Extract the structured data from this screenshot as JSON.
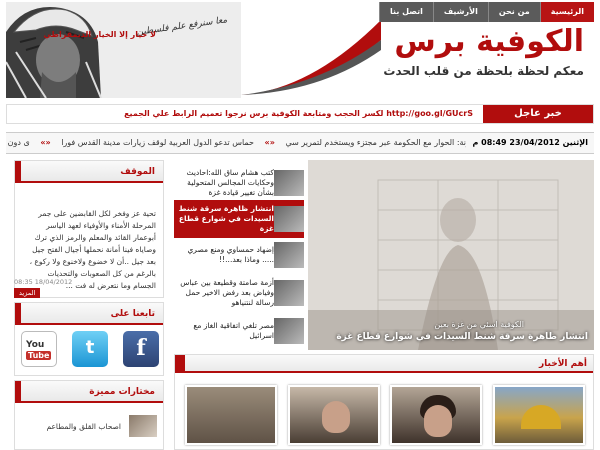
{
  "nav": {
    "items": [
      "الرئيسية",
      "من نحن",
      "الأرشيف",
      "اتصل بنا"
    ],
    "active_index": 0
  },
  "logo": {
    "title": "الكوفية برس",
    "subtitle": "معكم لحظة بلحظة من قلب الحدث"
  },
  "header_signature": "معا سنرفع علم فلسطين",
  "breaking": {
    "label": "خبر عاجل",
    "text": "لكسر الحجب ومتابعة الكوفية برس نرجوا تعميم الرابط علي الجميع http://goo.gl/GUcrS"
  },
  "ticker": {
    "date": "الإثنين 23/04/2012 08:49 م",
    "items": [
      "زكارنة: الحوار مع الحكومة عبر مجتزء ويستخدم لتمرير سي",
      "حماس تدعو الدول العربية لوقف زيارات مدينة القدس فورا",
      "ى دون اصابات"
    ],
    "separator": "«»"
  },
  "position_box": {
    "title": "الموقف",
    "heading": "لا خيار إلا الخيار الديمقراطي",
    "body": "تحية عز وفخر لكل القابضين على جمر المرحلة الأمناء والأوفياء لعهد الياسر أبوعمار القائد والمعلم والرمز الذي ترك وصاياه فينا أمانة نحملها أجيال الفتح جيل بعد جيل ..أن لا خضوع ولاخنوع ولا ركوع ، بالرغم من كل الصعوبات والتحديات الجسام وما نتعرض له فت ...",
    "date": "08:35 18/04/2012",
    "more_label": "المزيد"
  },
  "follow_box": {
    "title": "تابعنا على",
    "icons": [
      "youtube-icon",
      "twitter-icon",
      "facebook-icon"
    ],
    "youtube_you": "You",
    "youtube_tube": "Tube",
    "twitter_glyph": "t",
    "facebook_glyph": "f"
  },
  "picks_box": {
    "title": "مختارات مميزة",
    "items": [
      "اصحاب القلق والمطاعم"
    ]
  },
  "headlines": [
    "كتب هشام ساق الله:احاديث وحكايات المجالس المتحولية بشأن تغيير قيادة غزة",
    "انتشار ظاهرة سرقة شنط السيدات في شوارع قطاع غزة",
    "إضهاد حمساوي ومنع مصري ..... وماذا بعد...!!",
    "أزمة صامتة وقطيعة بين عباس وفياض بعد رفض الاخير حمل رسالة لنتنياهو",
    "مصر تلغي اتفاقية الغاز مع اسرائيل"
  ],
  "active_headline": 1,
  "featured": {
    "subcaption": "الكوفية اسئي من غزة بعين",
    "caption": "انتشار ظاهرة سرقة شنط السيدات في شوارع قطاع غزة"
  },
  "important": {
    "title": "أهم الأخبار"
  },
  "colors": {
    "brand_red": "#b10d0d",
    "nav_gray": "#5b5b5b"
  }
}
